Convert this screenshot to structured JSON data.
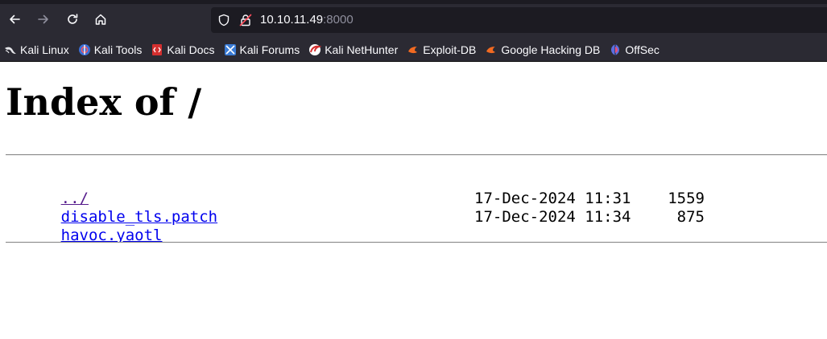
{
  "browser": {
    "url_host": "10.10.11.49",
    "url_port": ":8000",
    "bookmarks": [
      {
        "label": "Kali Linux",
        "icon": "kali-dragon-icon"
      },
      {
        "label": "Kali Tools",
        "icon": "kali-tools-icon"
      },
      {
        "label": "Kali Docs",
        "icon": "kali-docs-icon"
      },
      {
        "label": "Kali Forums",
        "icon": "kali-forums-icon"
      },
      {
        "label": "Kali NetHunter",
        "icon": "kali-nethunter-icon"
      },
      {
        "label": "Exploit-DB",
        "icon": "exploit-db-icon"
      },
      {
        "label": "Google Hacking DB",
        "icon": "ghdb-icon"
      },
      {
        "label": "OffSec",
        "icon": "offsec-icon"
      }
    ]
  },
  "page": {
    "title": "Index of /",
    "entries": [
      {
        "name": "../",
        "date": "",
        "size": ""
      },
      {
        "name": "disable_tls.patch",
        "date": "17-Dec-2024 11:31",
        "size": "1559"
      },
      {
        "name": "havoc.yaotl",
        "date": "17-Dec-2024 11:34",
        "size": "875"
      }
    ]
  }
}
